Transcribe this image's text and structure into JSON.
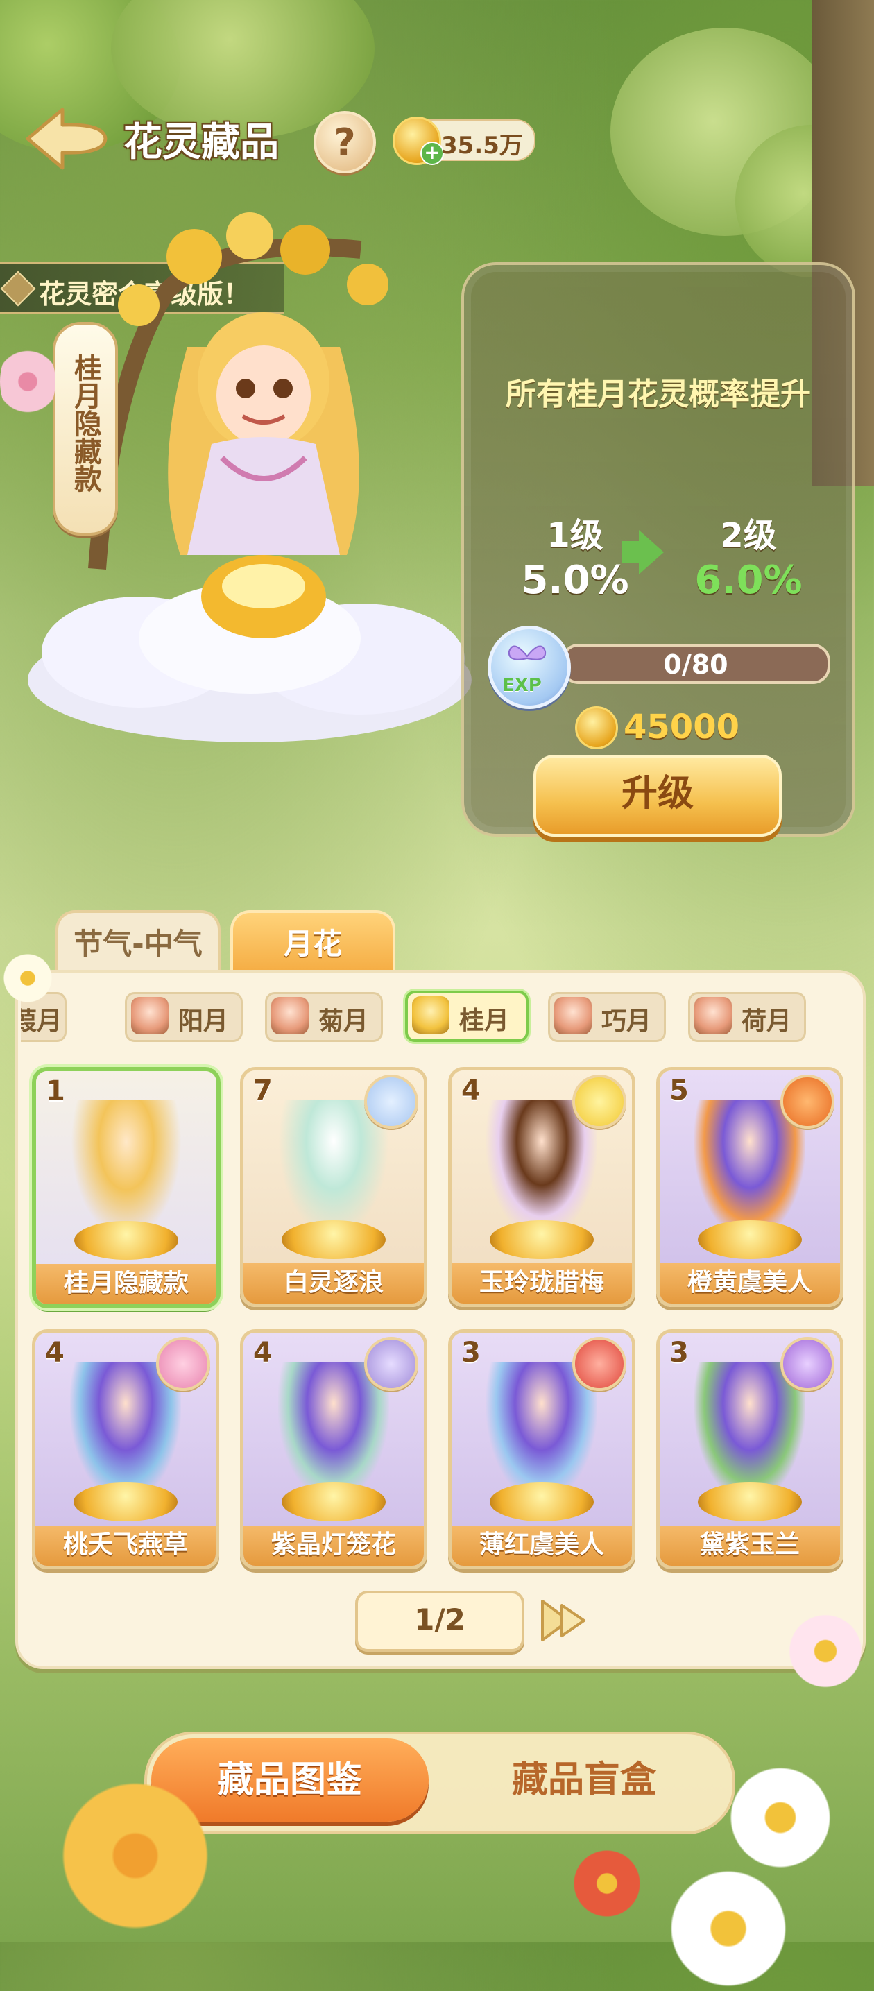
{
  "header": {
    "title": "花灵藏品",
    "help_symbol": "?",
    "coins": "35.5万"
  },
  "banner": {
    "text": "花灵密令高级版！"
  },
  "hero": {
    "tag": "桂月隐藏款"
  },
  "upgrade_panel": {
    "description": "所有桂月花灵概率提升",
    "from_level": "1级",
    "from_rate": "5.0%",
    "to_level": "2级",
    "to_rate": "6.0%",
    "exp_label": "EXP",
    "exp_value": "0/80",
    "exp_progress": 0,
    "cost": "45000",
    "upgrade_label": "升级"
  },
  "category_tabs": [
    {
      "label": "节气-中气"
    },
    {
      "label": "月花"
    }
  ],
  "month_tabs": [
    {
      "label": "葭月"
    },
    {
      "label": "阳月"
    },
    {
      "label": "菊月"
    },
    {
      "label": "桂月"
    },
    {
      "label": "巧月"
    },
    {
      "label": "荷月"
    }
  ],
  "cards": [
    {
      "count": "1",
      "name": "桂月隐藏款"
    },
    {
      "count": "7",
      "name": "白灵逐浪"
    },
    {
      "count": "4",
      "name": "玉玲珑腊梅"
    },
    {
      "count": "5",
      "name": "橙黄虞美人"
    },
    {
      "count": "4",
      "name": "桃夭飞燕草"
    },
    {
      "count": "4",
      "name": "紫晶灯笼花"
    },
    {
      "count": "3",
      "name": "薄红虞美人"
    },
    {
      "count": "3",
      "name": "黛紫玉兰"
    }
  ],
  "pagination": {
    "page": "1/2"
  },
  "bottom_tabs": [
    {
      "label": "藏品图鉴"
    },
    {
      "label": "藏品盲盒"
    }
  ],
  "colors": {
    "accent": "#f3a63a",
    "selected": "#8ed15a",
    "gold": "#ffd34a"
  }
}
